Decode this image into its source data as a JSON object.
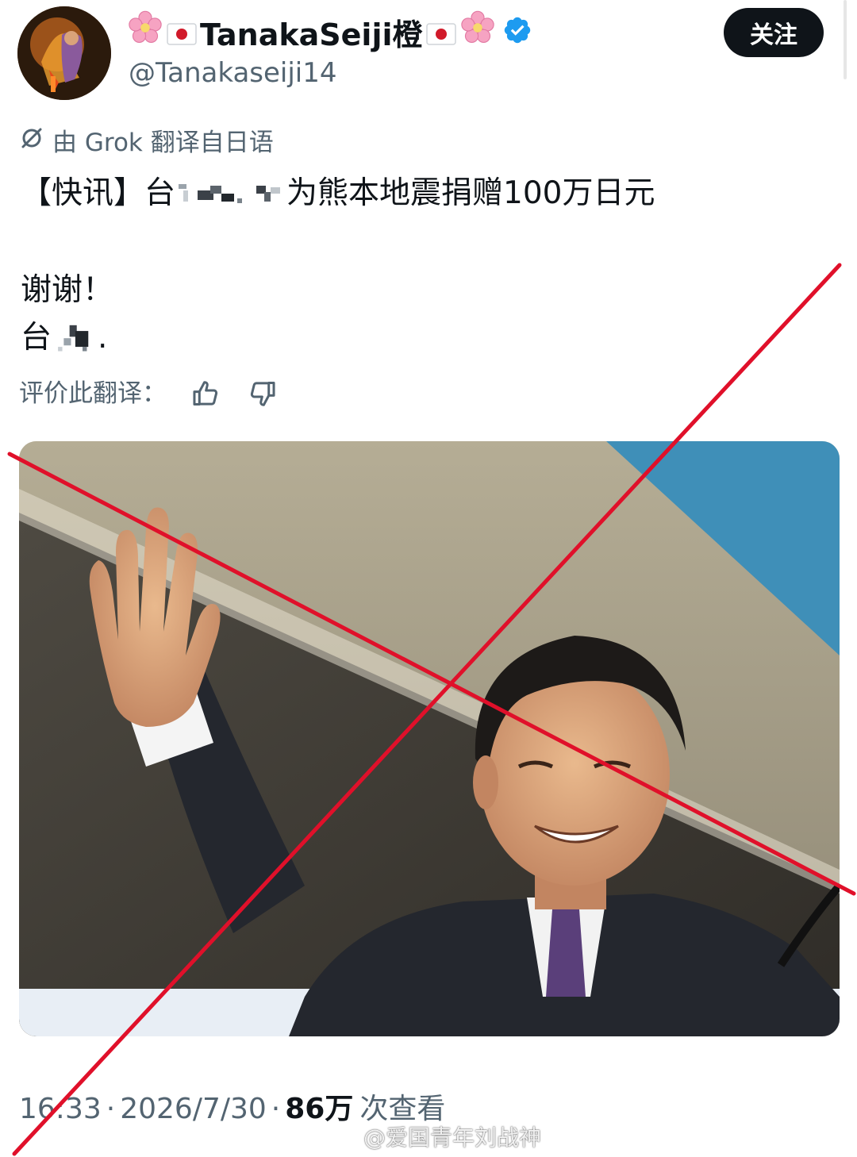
{
  "header": {
    "display_name": "TanakaSeiji橙",
    "handle": "@Tanakaseiji14",
    "follow_label": "关注",
    "accent_color": "#1d9bf0"
  },
  "translation": {
    "note": "由 Grok 翻译自日语",
    "rate_label": "评价此翻译："
  },
  "tweet": {
    "line1_prefix": "【快讯】台",
    "line1_suffix": "为熊本地震捐赠100万日元",
    "line2": "谢谢！",
    "line3_prefix": "台",
    "line3_suffix": "."
  },
  "meta": {
    "time": "16:33",
    "date": "2026/7/30",
    "views_count": "86万",
    "views_label": "次查看"
  },
  "watermark": {
    "text": "@爱国青年刘战神"
  },
  "icons": {
    "verified": "verified-badge-icon",
    "translate": "translate-icon",
    "thumb_up": "thumbs-up-icon",
    "thumb_down": "thumbs-down-icon",
    "flag": "japan-flag-icon",
    "flower": "cherry-blossom-icon",
    "weibo": "weibo-logo-icon"
  },
  "colors": {
    "text": "#0f1419",
    "secondary": "#536471",
    "overlay_x": "#e0102a"
  }
}
